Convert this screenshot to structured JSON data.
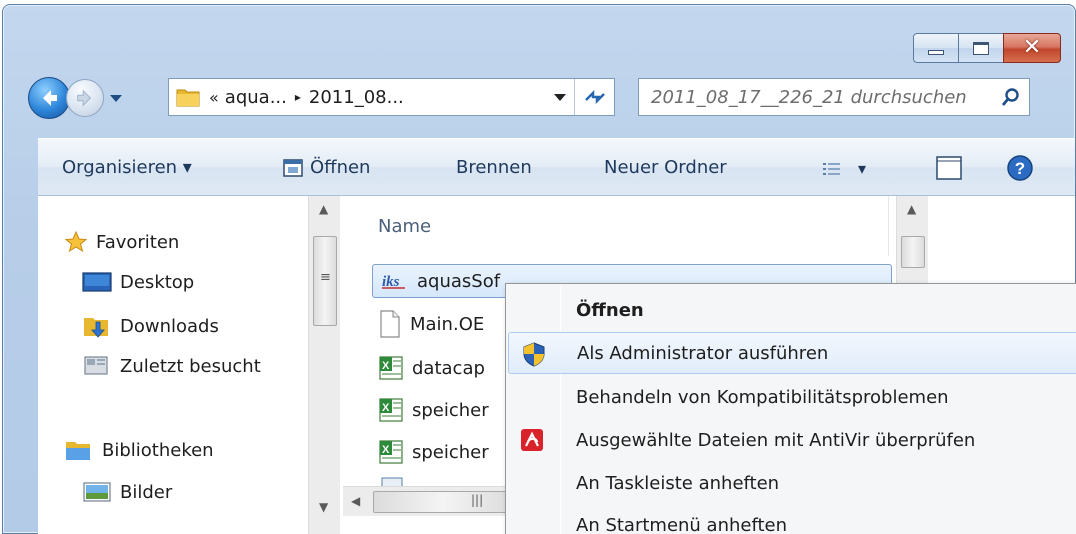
{
  "window": {
    "caption_buttons": {
      "minimize": "minimize",
      "maximize": "maximize",
      "close": "close"
    }
  },
  "address_bar": {
    "overflow_chevron": "«",
    "segment1": "aqua...",
    "separator": "▸",
    "segment2": "2011_08...",
    "refresh_symbol": "↻"
  },
  "search": {
    "placeholder": "2011_08_17__226_21 durchsuchen"
  },
  "toolbar": {
    "organize": "Organisieren ▾",
    "open": "Öffnen",
    "burn": "Brennen",
    "new_folder": "Neuer Ordner",
    "view_arrow": "▾"
  },
  "navigation": {
    "favorites": "Favoriten",
    "desktop": "Desktop",
    "downloads": "Downloads",
    "recent": "Zuletzt besucht",
    "libraries": "Bibliotheken",
    "pictures": "Bilder"
  },
  "files": {
    "column_name": "Name",
    "rows": [
      {
        "name": "aquasSof",
        "icon": "iks-app-icon",
        "selected": true
      },
      {
        "name": "Main.OE",
        "icon": "document-icon",
        "selected": false
      },
      {
        "name": "datacap",
        "icon": "excel-icon",
        "selected": false
      },
      {
        "name": "speicher",
        "icon": "excel-icon",
        "selected": false
      },
      {
        "name": "speicher",
        "icon": "excel-icon",
        "selected": false
      }
    ]
  },
  "context_menu": {
    "items": [
      {
        "label": "Öffnen",
        "bold": true,
        "icon": ""
      },
      {
        "label": "Als Administrator ausführen",
        "bold": false,
        "icon": "uac-shield-icon",
        "hover": true
      },
      {
        "label": "Behandeln von Kompatibilitätsproblemen",
        "bold": false,
        "icon": ""
      },
      {
        "label": "Ausgewählte Dateien mit AntiVir überprüfen",
        "bold": false,
        "icon": "antivir-icon"
      },
      {
        "label": "An Taskleiste anheften",
        "bold": false,
        "icon": ""
      },
      {
        "label": "An Startmenü anheften",
        "bold": false,
        "icon": ""
      }
    ]
  },
  "colors": {
    "frame": "#b7cde8",
    "toolbar_text": "#1e395b",
    "selection_border": "#7da2ce",
    "menu_bg": "#f5f6f7"
  }
}
